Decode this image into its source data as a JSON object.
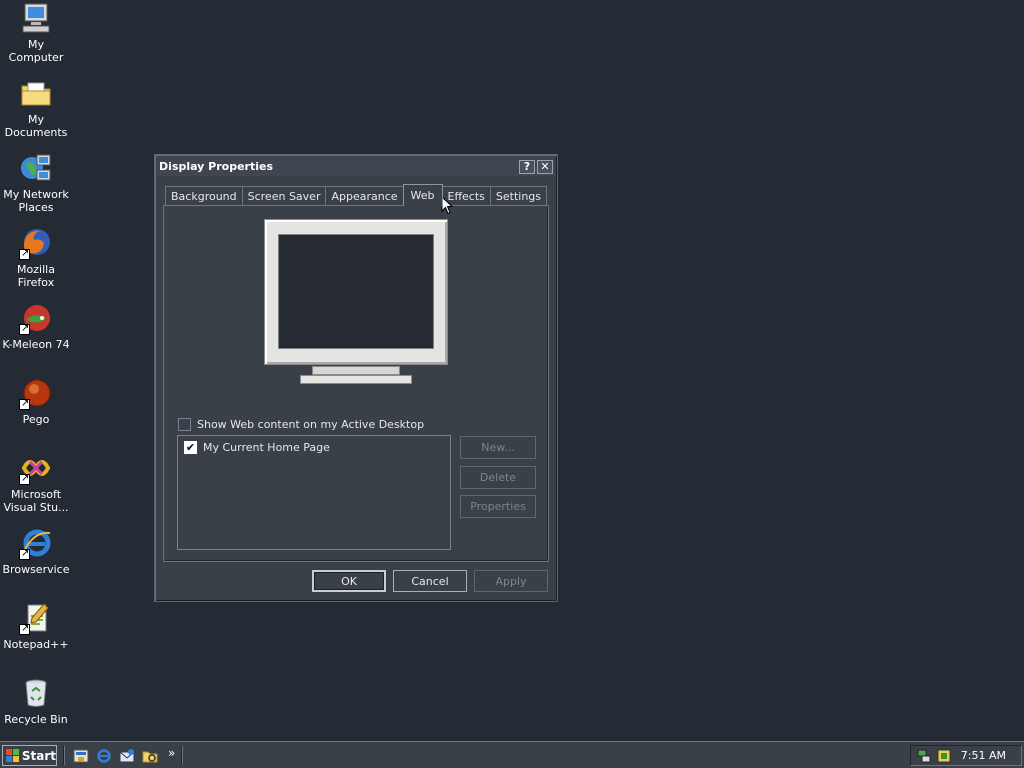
{
  "desktop": {
    "icons": [
      {
        "label": "My Computer"
      },
      {
        "label": "My Documents"
      },
      {
        "label": "My Network Places"
      },
      {
        "label": "Mozilla Firefox"
      },
      {
        "label": "K-Meleon 74"
      },
      {
        "label": "Pego"
      },
      {
        "label": "Microsoft Visual Stu..."
      },
      {
        "label": "Browservice"
      },
      {
        "label": "Notepad++"
      },
      {
        "label": "Recycle Bin"
      }
    ]
  },
  "dialog": {
    "title": "Display Properties",
    "help_glyph": "?",
    "close_glyph": "✕",
    "tabs": [
      {
        "label": "Background",
        "active": false
      },
      {
        "label": "Screen Saver",
        "active": false
      },
      {
        "label": "Appearance",
        "active": false
      },
      {
        "label": "Web",
        "active": true
      },
      {
        "label": "Effects",
        "active": false
      },
      {
        "label": "Settings",
        "active": false
      }
    ],
    "web": {
      "show_web_content_label": "Show Web content on my Active Desktop",
      "show_web_content_checked": false,
      "list_items": [
        {
          "label": "My Current Home Page",
          "checked": true
        }
      ],
      "new_label": "New...",
      "delete_label": "Delete",
      "properties_label": "Properties"
    },
    "ok_label": "OK",
    "cancel_label": "Cancel",
    "apply_label": "Apply"
  },
  "taskbar": {
    "start_label": "Start",
    "more_glyph": "»",
    "clock": "7:51 AM"
  }
}
